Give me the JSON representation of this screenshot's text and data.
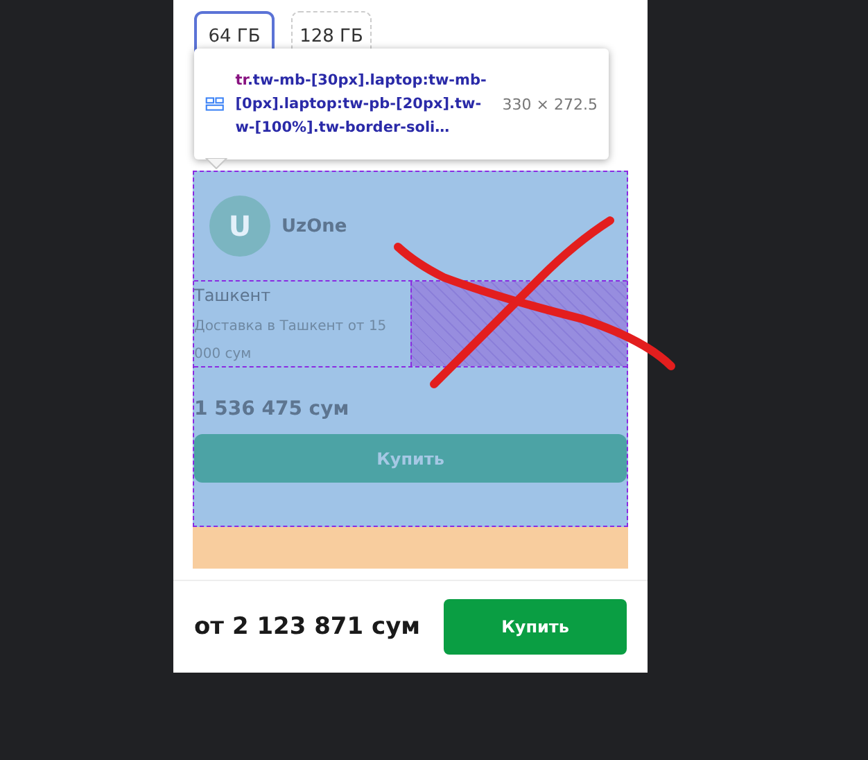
{
  "memory_options": [
    {
      "label": "64 ГБ",
      "selected": true
    },
    {
      "label": "128 ГБ",
      "selected": false
    }
  ],
  "inspector_tooltip": {
    "tag": "tr",
    "classes": ".tw-mb-[30px].laptop:tw-mb-[0px].laptop:tw-pb-[20px].tw-w-[100%].tw-border-soli…",
    "size": "330 × 272.5"
  },
  "offer": {
    "avatar_letter": "U",
    "seller": "UzOne",
    "city": "Ташкент",
    "delivery": "Доставка в Ташкент от 15 000 сум",
    "price": "1 536 475 сум",
    "buy_button": "Купить"
  },
  "footer": {
    "price": "от 2 123 871 сум",
    "buy_button": "Купить"
  }
}
